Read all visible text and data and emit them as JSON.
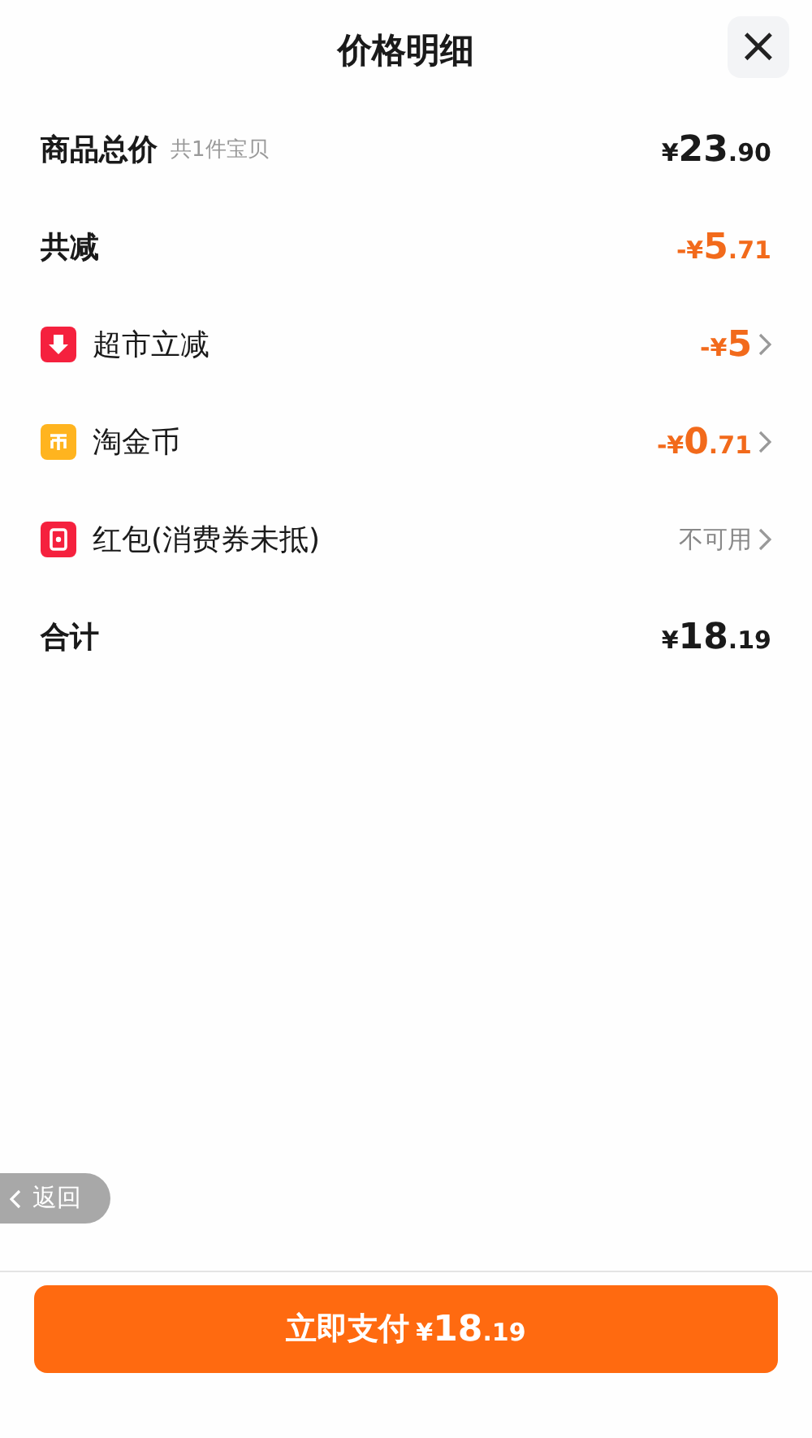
{
  "header": {
    "title": "价格明细",
    "close": "×"
  },
  "rows": [
    {
      "kind": "plain",
      "label": "商品总价",
      "note": "共1件宝贝",
      "price": {
        "kind": "regular",
        "prefix": "¥",
        "whole": "23",
        "fraction": ".90"
      }
    },
    {
      "kind": "plain",
      "label": "共减",
      "price": {
        "kind": "discount",
        "prefix": "-¥",
        "whole": "5",
        "fraction": ".71"
      }
    },
    {
      "kind": "link",
      "label": "超市立减",
      "price": {
        "kind": "discount",
        "prefix": "-¥",
        "whole": "5"
      }
    },
    {
      "kind": "link",
      "label": "淘金币",
      "price": {
        "kind": "discount",
        "prefix": "-¥",
        "whole": "0",
        "fraction": ".71"
      }
    },
    {
      "kind": "link",
      "label": "红包(消费券未抵)",
      "status": "不可用"
    },
    {
      "kind": "plain",
      "label": "合计",
      "price": {
        "kind": "regular",
        "prefix": "¥",
        "whole": "18",
        "fraction": ".19"
      }
    }
  ],
  "back": {
    "label": "返回"
  },
  "pay": {
    "label": "立即支付",
    "price": {
      "prefix": "¥",
      "whole": "18",
      "fraction": ".19"
    }
  }
}
